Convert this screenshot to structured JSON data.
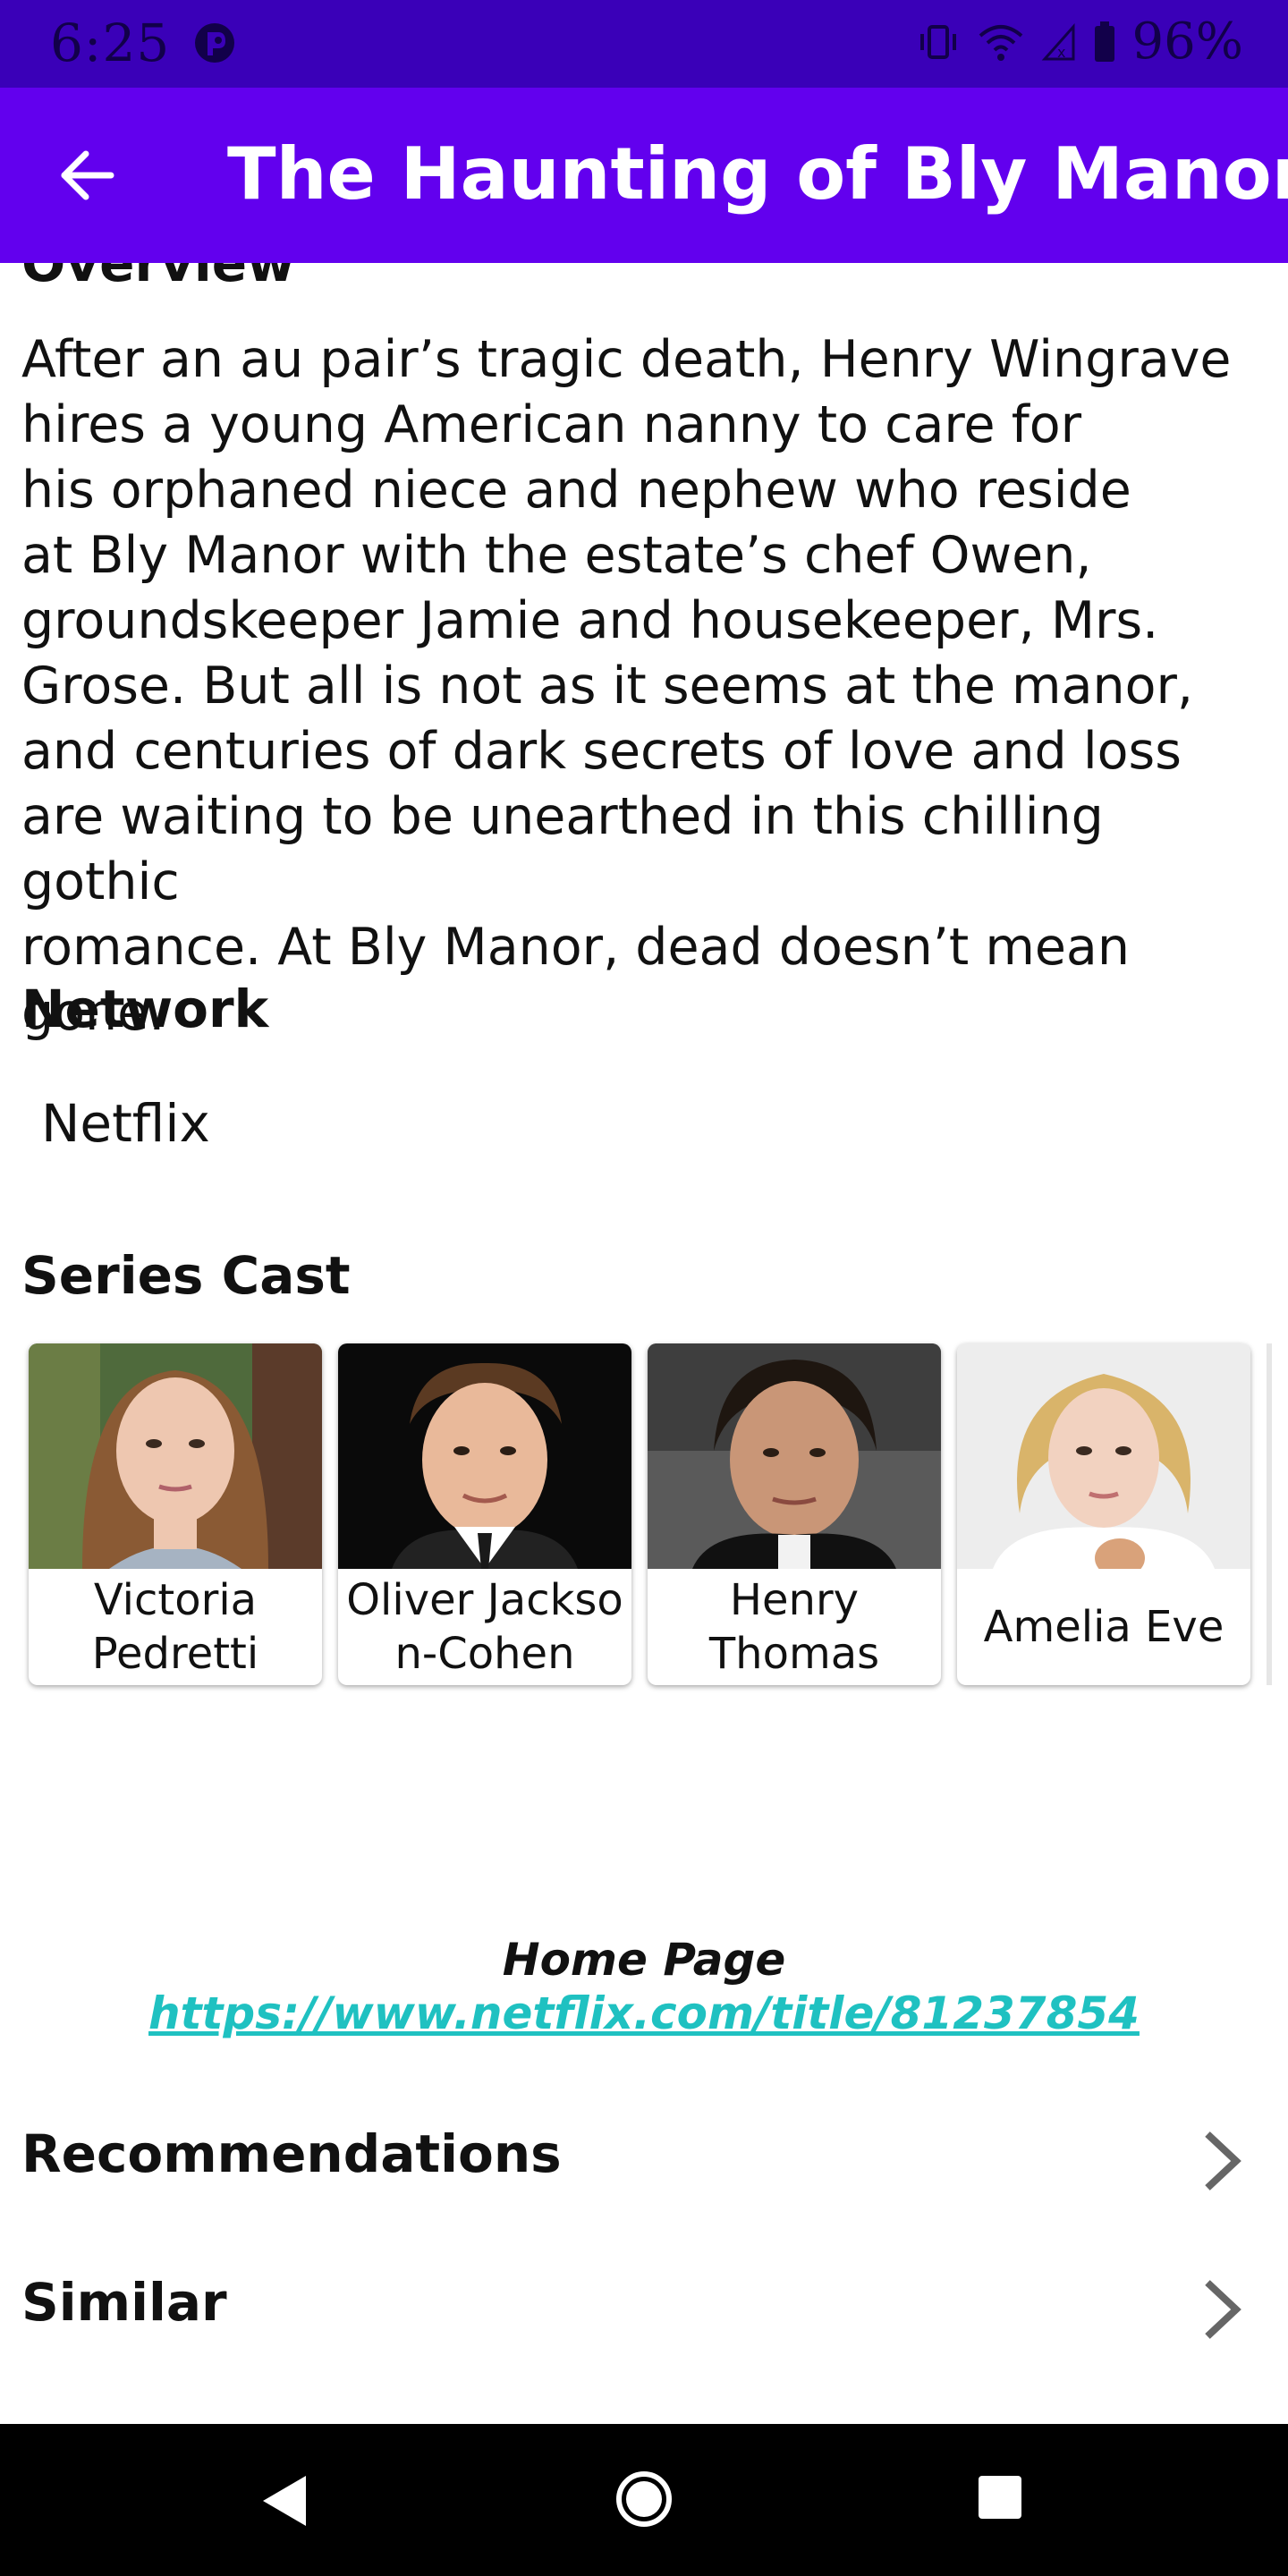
{
  "status_bar": {
    "time": "6:25",
    "battery": "96%"
  },
  "app_bar": {
    "title": "The Haunting of Bly Manor"
  },
  "overview": {
    "heading": "Overview",
    "lines": [
      "After an au pair’s tragic death, Henry Wingrave",
      "hires a young American nanny to care for",
      "his orphaned niece and nephew who reside",
      "at Bly Manor with the estate’s chef Owen,",
      "groundskeeper Jamie and housekeeper, Mrs.",
      "Grose. But all is not as it seems at the manor,",
      "and centuries of dark secrets of love and loss",
      "are waiting to be unearthed in this chilling gothic",
      "romance. At Bly Manor, dead doesn’t mean gone."
    ]
  },
  "network": {
    "heading": "Network",
    "value": "Netflix"
  },
  "cast": {
    "heading": "Series Cast",
    "members": [
      {
        "name_line1": "Victoria",
        "name_line2": "Pedretti"
      },
      {
        "name_line1": "Oliver Jackso",
        "name_line2": "n-Cohen"
      },
      {
        "name_line1": "Henry",
        "name_line2": "Thomas"
      },
      {
        "name_line1": "Amelia Eve",
        "name_line2": ""
      }
    ]
  },
  "home_page": {
    "label": "Home Page",
    "url": "https://www.netflix.com/title/81237854"
  },
  "links": {
    "recommendations": "Recommendations",
    "similar": "Similar"
  },
  "colors": {
    "status_bar": "#3a00b8",
    "app_bar": "#6200ee",
    "link": "#1fc1c1"
  }
}
